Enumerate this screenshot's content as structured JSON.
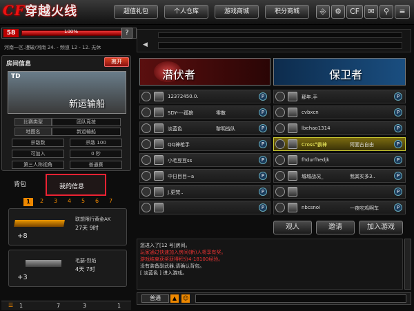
{
  "topbar": {
    "logo": "穿越火线",
    "nav": [
      "超值礼包",
      "个人仓库",
      "游戏商城",
      "积分商城"
    ]
  },
  "level": {
    "level": "58",
    "exp": "100%",
    "progress": 1.0
  },
  "server": "河南一区.漫破/河南 24. - 频道 12 - 12. 无休",
  "room": {
    "title": "房间信息",
    "quit": "离开",
    "id": "TD",
    "map_name": "新运输船",
    "settings": [
      {
        "label": "比赛类型",
        "value": "团队竞技"
      },
      {
        "label": "地图名",
        "value": "新运输船"
      }
    ],
    "grid": [
      [
        "杀敌数",
        "杀敌 100"
      ],
      [
        "可加入",
        "0 秒"
      ],
      [
        "第三人称视角",
        "普通赛"
      ]
    ]
  },
  "tabs": {
    "bag": "背包",
    "info": "我的信息",
    "pages": [
      "1",
      "2",
      "3",
      "4",
      "5",
      "6",
      "7"
    ]
  },
  "items": [
    {
      "name": "联想限行黄金AK",
      "time": "27天 9时",
      "plus": "+8"
    },
    {
      "name": "毛瑟-烈焰",
      "time": "4天 7时",
      "plus": "+3"
    }
  ],
  "bottom_stats": [
    "1",
    "7",
    "3",
    "1"
  ],
  "teams": {
    "left": "潜伏者",
    "right": "保卫者"
  },
  "players_left": [
    "12372450.0.",
    "SDY----孤狼",
    "淡蓝色",
    "QQ神枪手",
    "小毛豆豆ss",
    "中日目目~a",
    "J.更梵..",
    ""
  ],
  "left_clan": [
    "",
    "零散",
    "黎明战队",
    "",
    "",
    "",
    "",
    ""
  ],
  "players_right": [
    "那年.手",
    "cvbxcn",
    "lbehao1314",
    "Cross°霸神",
    "fhdurfhedjk",
    "城城战况_",
    "",
    "nbcsnoi"
  ],
  "right_clan": [
    "",
    "",
    "",
    "阿面古自由",
    "",
    "我其实多3..",
    "",
    "一夜吃鸡啊车"
  ],
  "actions": {
    "invite": "邀请",
    "join": "加入游戏",
    "other": "观人"
  },
  "chat": [
    {
      "text": "您进入了[12 号]房间。",
      "color": "#ddd"
    },
    {
      "text": "玩家通过快速加入房间(新)人将享有奖。",
      "color": "#e33"
    },
    {
      "text": "游戏结束获奖获得积分4-18100经验。",
      "color": "#e33"
    },
    {
      "text": "没有装备副武器,请确认背包。",
      "color": "#ccc"
    },
    {
      "text": "[ 淡蓝色 ] 进入游戏。",
      "color": "#ddd"
    }
  ],
  "chat_mode": "普通"
}
